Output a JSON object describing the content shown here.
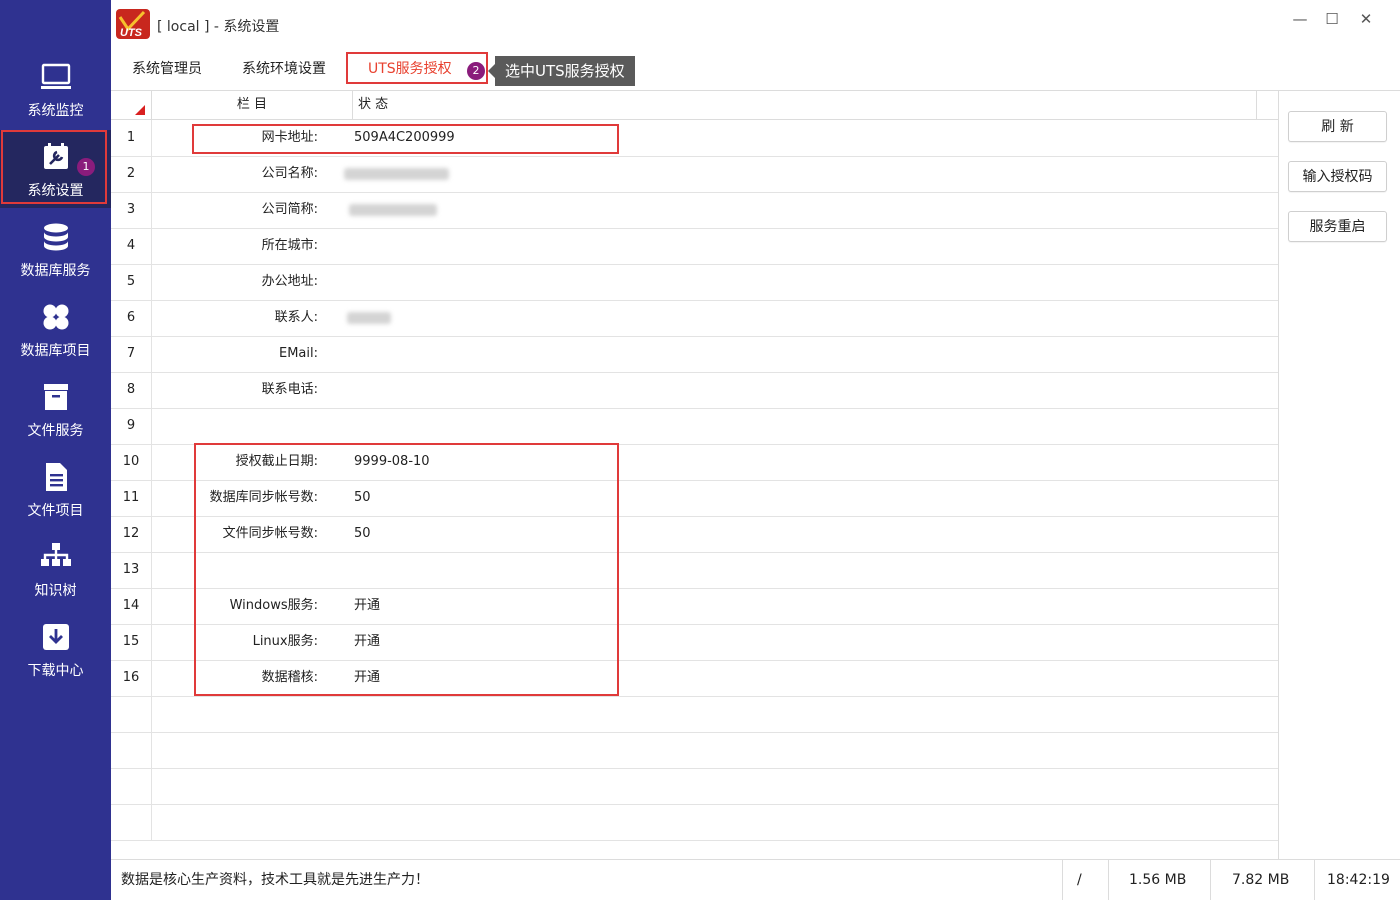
{
  "window": {
    "title": "[ local ] - 系统设置",
    "logo_text": "UTS",
    "controls": {
      "minimize": "—",
      "maximize": "☐",
      "close": "✕"
    }
  },
  "sidebar": {
    "items": [
      {
        "label": "系统监控",
        "icon": "monitor-icon"
      },
      {
        "label": "系统设置",
        "icon": "settings-calendar-icon",
        "active": true,
        "badge": "1"
      },
      {
        "label": "数据库服务",
        "icon": "database-icon"
      },
      {
        "label": "数据库项目",
        "icon": "grid-clover-icon"
      },
      {
        "label": "文件服务",
        "icon": "file-box-icon"
      },
      {
        "label": "文件项目",
        "icon": "file-list-icon"
      },
      {
        "label": "知识树",
        "icon": "org-tree-icon"
      },
      {
        "label": "下载中心",
        "icon": "download-icon"
      }
    ]
  },
  "tabs": {
    "items": [
      {
        "label": "系统管理员"
      },
      {
        "label": "系统环境设置"
      },
      {
        "label": "UTS服务授权",
        "active": true,
        "badge": "2"
      }
    ],
    "tooltip": "选中UTS服务授权"
  },
  "grid": {
    "columns": {
      "field": "栏 目",
      "value": "状 态"
    },
    "rows": [
      {
        "num": "1",
        "field": "网卡地址:",
        "value": "509A4C200999"
      },
      {
        "num": "2",
        "field": "公司名称:",
        "value": ""
      },
      {
        "num": "3",
        "field": "公司简称:",
        "value": ""
      },
      {
        "num": "4",
        "field": "所在城市:",
        "value": ""
      },
      {
        "num": "5",
        "field": "办公地址:",
        "value": ""
      },
      {
        "num": "6",
        "field": "联系人:",
        "value": ""
      },
      {
        "num": "7",
        "field": "EMail:",
        "value": ""
      },
      {
        "num": "8",
        "field": "联系电话:",
        "value": ""
      },
      {
        "num": "9",
        "field": "",
        "value": ""
      },
      {
        "num": "10",
        "field": "授权截止日期:",
        "value": "9999-08-10"
      },
      {
        "num": "11",
        "field": "数据库同步帐号数:",
        "value": "50"
      },
      {
        "num": "12",
        "field": "文件同步帐号数:",
        "value": "50"
      },
      {
        "num": "13",
        "field": "",
        "value": ""
      },
      {
        "num": "14",
        "field": "Windows服务:",
        "value": "开通"
      },
      {
        "num": "15",
        "field": "Linux服务:",
        "value": "开通"
      },
      {
        "num": "16",
        "field": "数据稽核:",
        "value": "开通"
      }
    ]
  },
  "actions": {
    "refresh": "刷 新",
    "enter_code": "输入授权码",
    "restart": "服务重启"
  },
  "status": {
    "message": "数据是核心生产资料，技术工具就是先进生产力！",
    "sep": "/",
    "mem1": "1.56 MB",
    "mem2": "7.82 MB",
    "time": "18:42:19"
  },
  "colors": {
    "sidebar": "#2f3290",
    "accent": "#e8412f",
    "highlight": "#e03a3a",
    "badge": "#8a1c7c"
  }
}
